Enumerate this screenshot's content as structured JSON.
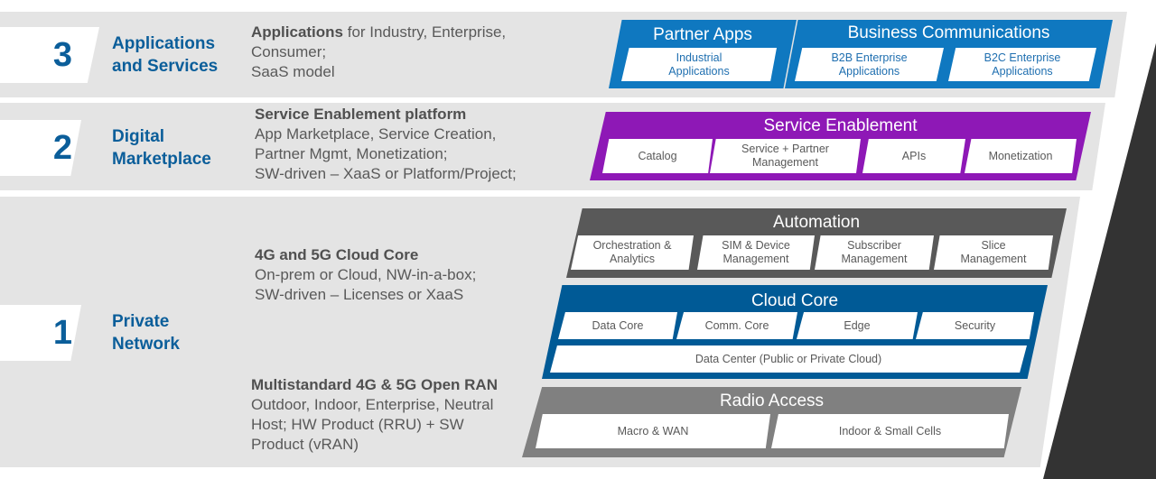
{
  "colors": {
    "band_bg": "#e4e4e4",
    "layer_blue": "#0b5e9a",
    "partner_blue": "#0f78c0",
    "purple": "#8e18b6",
    "automation_gray": "#595959",
    "cloud_blue": "#005a96",
    "radio_gray": "#808080",
    "dark_wedge": "#333333"
  },
  "layers": [
    {
      "number": "3",
      "title_line1": "Applications",
      "title_line2": "and Services",
      "desc_bold": "Applications",
      "desc_line1_rest": " for Industry, Enterprise,",
      "desc_line2": "Consumer;",
      "desc_line3": "SaaS model"
    },
    {
      "number": "2",
      "title_line1": "Digital",
      "title_line2": "Marketplace",
      "desc_bold": "Service Enablement platform",
      "desc_line2": "App Marketplace, Service Creation,",
      "desc_line3": "Partner Mgmt, Monetization;",
      "desc_line4": "SW-driven – XaaS or Platform/Project;"
    },
    {
      "number": "1",
      "title_line1": "Private",
      "title_line2": "Network",
      "core_bold": "4G and 5G Cloud Core",
      "core_line2": "On-prem or Cloud, NW-in-a-box;",
      "core_line3": "SW-driven – Licenses or XaaS",
      "ran_bold": "Multistandard 4G & 5G Open RAN",
      "ran_line2": "Outdoor, Indoor, Enterprise, Neutral",
      "ran_line3": "Host; HW Product (RRU) + SW",
      "ran_line4": "Product (vRAN)"
    }
  ],
  "panels": {
    "partner_apps": {
      "title": "Partner Apps",
      "cells": [
        "Industrial\nApplications"
      ]
    },
    "business_comms": {
      "title": "Business Communications",
      "cells": [
        "B2B Enterprise\nApplications",
        "B2C Enterprise\nApplications"
      ]
    },
    "service_enablement": {
      "title": "Service Enablement",
      "cells": [
        "Catalog",
        "Service  + Partner\nManagement",
        "APIs",
        "Monetization"
      ]
    },
    "automation": {
      "title": "Automation",
      "cells": [
        "Orchestration &\nAnalytics",
        "SIM & Device\nManagement",
        "Subscriber\nManagement",
        "Slice\nManagement"
      ]
    },
    "cloud_core": {
      "title": "Cloud Core",
      "cells": [
        "Data Core",
        "Comm. Core",
        "Edge",
        "Security"
      ],
      "wide_cell": "Data Center (Public or Private Cloud)"
    },
    "radio_access": {
      "title": "Radio Access",
      "cells": [
        "Macro & WAN",
        "Indoor & Small Cells"
      ]
    }
  }
}
